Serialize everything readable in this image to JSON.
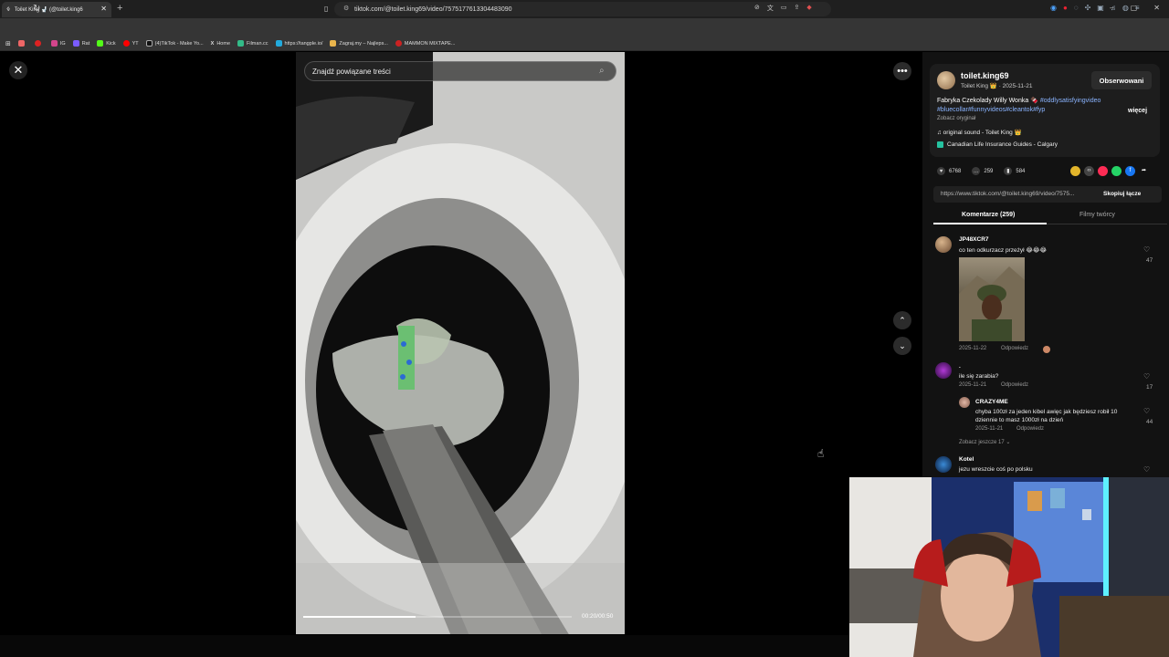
{
  "browser": {
    "tab_title": "Toilet King 🚽 (@toilet.king6",
    "url": "tiktok.com/@toilet.king69/video/7575177613304483090",
    "bookmarks": [
      "",
      "",
      "IG",
      "Rat",
      "Kick",
      "YT",
      "(4)TikTok - Make Yo...",
      "Home",
      "Filman.cc",
      "https://tangple.io/",
      "Zagraj.my – Najleps...",
      "MAMMON MIXTAPE..."
    ]
  },
  "viewer": {
    "search_placeholder": "Znajdź powiązane treści",
    "time": "00:20/00:50",
    "progress_fraction": 0.42
  },
  "creator": {
    "username": "toilet.king69",
    "display_line": "Toilet King 👑 · 2025-11-21",
    "follow_label": "Obserwowani",
    "description": "Fabryka Czekolady Willy Wonka 🍫",
    "tags_line1": "#oddlysatisfyingvideo",
    "tags_line2": "#bluecollar#funnyvideos#cleantok#fyp",
    "more_label": "więcej",
    "original_label": "Zobacz oryginał",
    "sound": "♫  original sound - Toilet King 👑",
    "place": "Canadian Life Insurance Guides - Calgary"
  },
  "stats": {
    "likes": "6768",
    "comments": "259",
    "saves": "584"
  },
  "link": {
    "url": "https://www.tiktok.com/@toilet.king69/video/7575...",
    "copy_label": "Skopiuj łącze"
  },
  "tabs": {
    "comments": "Komentarze (259)",
    "videos": "Filmy twórcy"
  },
  "comments": [
    {
      "name": "JP48XCR7",
      "text": "co ten odkurzacz przeżył 😂😂😂",
      "date": "2025-11-22",
      "reply": "Odpowiedz",
      "likes": "47"
    },
    {
      "name": ".",
      "text": "ile się zarabia?",
      "date": "2025-11-21",
      "reply": "Odpowiedz",
      "likes": "17"
    },
    {
      "name": "CRAZY4ME",
      "text": "chyba 100zł za jeden kibel awięc jak będziesz robił 10 dziennie to masz 1000zł na dzień",
      "date": "2025-11-21",
      "reply": "Odpowiedz",
      "likes": "44"
    },
    {
      "name": "Kotel",
      "text": "jezu wreszcie coś po polsku"
    }
  ],
  "see_more_replies": "Zobacz jeszcze 17 ⌄",
  "colors": {
    "accent_link": "#8ab4ff",
    "panel_bg": "#121212"
  }
}
